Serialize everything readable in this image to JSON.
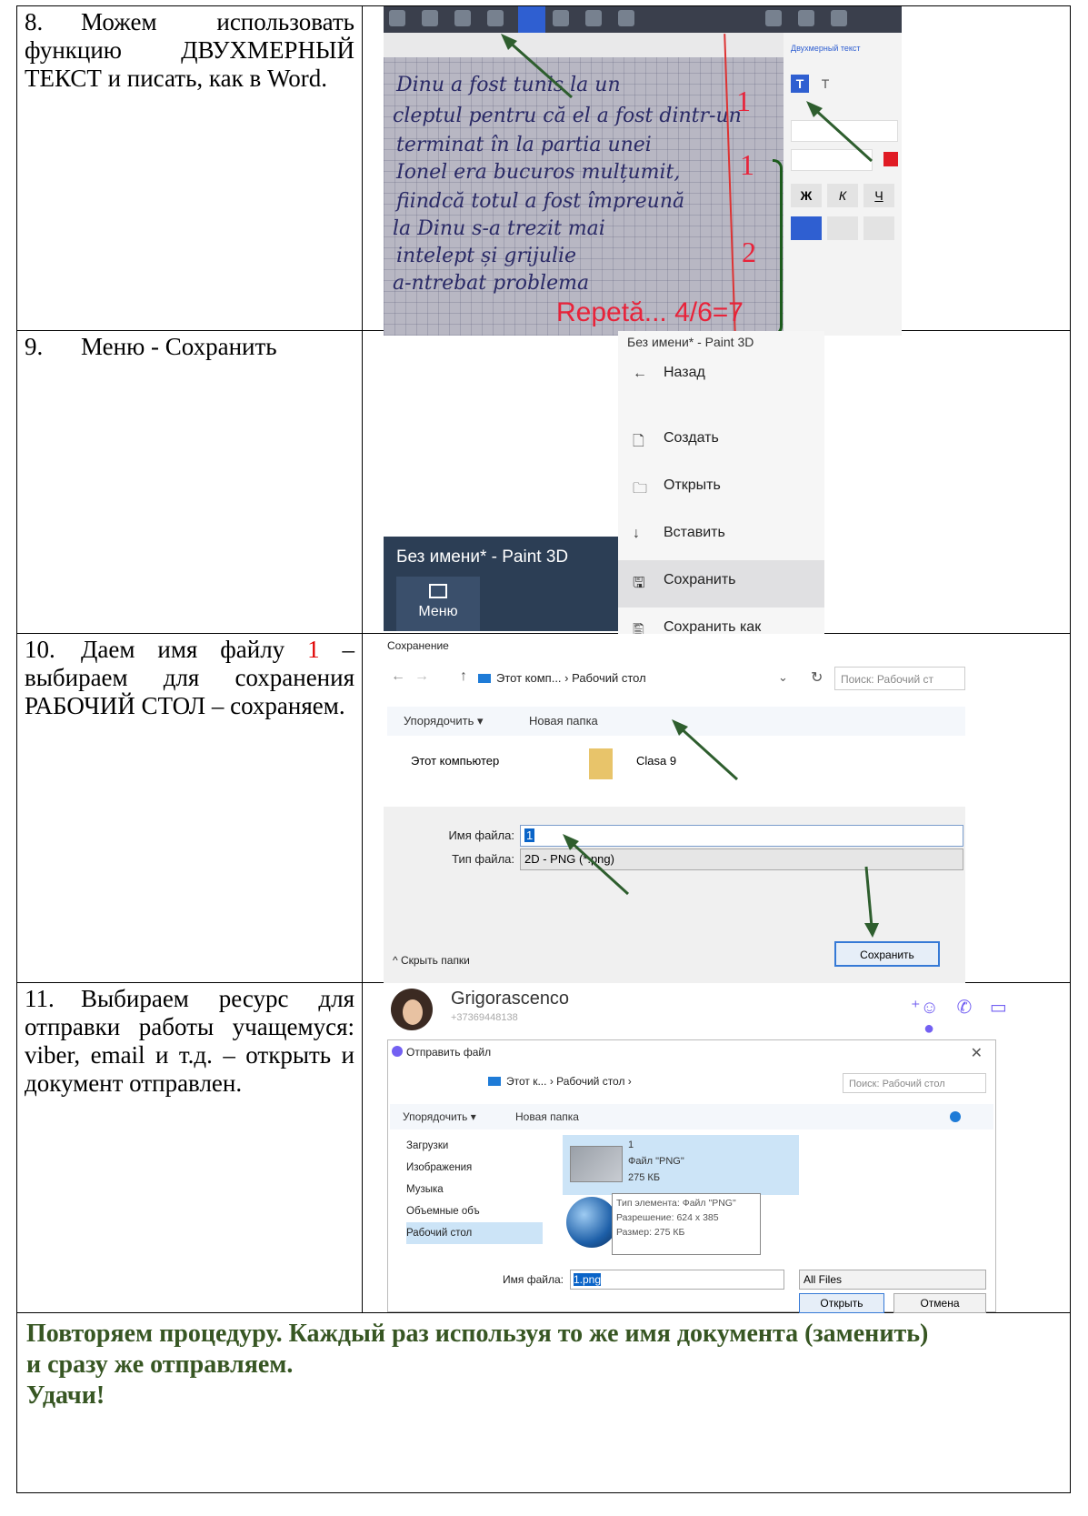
{
  "rows": [
    {
      "num": "8.",
      "pre": "Можем использовать функцию ДВУХМЕРНЫЙ ТЕКСТ и писать, как в Word.",
      "red": "",
      "post": ""
    },
    {
      "num": "9.",
      "pre": "Меню - Сохранить",
      "red": "",
      "post": ""
    },
    {
      "num": "10.",
      "pre": "Даем имя файлу ",
      "red": "1",
      "post": " – выбираем для сохранения РАБОЧИЙ СТОЛ – сохраняем."
    },
    {
      "num": "11.",
      "pre": "Выбираем ресурс для отправки работы учащемуся: viber, email и т.д. – открыть и документ отправлен.",
      "red": "",
      "post": ""
    }
  ],
  "footer": {
    "line1": "Повторяем процедуру. Каждый раз используя то же имя документа (заменить)",
    "line2": "и сразу же отправляем.",
    "line3": "Удачи!"
  },
  "shot8": {
    "panel_title": "Двухмерный текст",
    "bold": "Ж",
    "italic": "К",
    "underline": "Ч",
    "handwriting": [
      "Dinu a fost tunis la un",
      "cleptul pentru că el a fost dintr-un",
      "terminat în la partia unei",
      "Ionel era bucuros mulțumit,",
      "fiindcă totul a fost împreună",
      "la Dinu s-a trezit mai",
      "intelept și grijulie",
      "a-ntrebat problema",
      "Repetă… 4/6=7"
    ],
    "repeta": "Repetă... 4/6=7",
    "marks": [
      "1",
      "1",
      "2"
    ]
  },
  "shot9": {
    "window_title": "Без имени* - Paint 3D",
    "menu_button": "Меню",
    "header": "Без имени* - Paint 3D",
    "items": [
      {
        "icon": "←",
        "label": "Назад"
      },
      {
        "icon": "🗋",
        "label": "Создать"
      },
      {
        "icon": "🗀",
        "label": "Открыть"
      },
      {
        "icon": "↓",
        "label": "Вставить"
      },
      {
        "icon": "🖫",
        "label": "Сохранить"
      },
      {
        "icon": "🖺",
        "label": "Сохранить как"
      }
    ]
  },
  "shot10": {
    "title": "Сохранение",
    "path": "Этот комп... › Рабочий стол",
    "search": "Поиск: Рабочий ст",
    "organize": "Упорядочить ▾",
    "new_folder": "Новая папка",
    "tree_item": "Этот компьютер",
    "folder": "Clasa 9",
    "filename_label": "Имя файла:",
    "filename_value": "1",
    "filetype_label": "Тип файла:",
    "filetype_value": "2D - PNG (*.png)",
    "hide_folders": "Скрыть папки",
    "save_button": "Сохранить"
  },
  "shot11": {
    "contact_name": "Grigorascenco",
    "contact_phone": "+37369448138",
    "dialog_title": "Отправить файл",
    "path": "Этот к... › Рабочий стол ›",
    "search": "Поиск: Рабочий стол",
    "organize": "Упорядочить ▾",
    "new_folder": "Новая папка",
    "tree": [
      "Загрузки",
      "Изображения",
      "Музыка",
      "Объемные объ",
      "Рабочий стол"
    ],
    "file_name": "1",
    "file_type": "Файл \"PNG\"",
    "file_size": "275 КБ",
    "tooltip": [
      "Тип элемента: Файл \"PNG\"",
      "Разрешение: 624 x 385",
      "Размер: 275 КБ"
    ],
    "filename_label": "Имя файла:",
    "filename_value": "1.png",
    "filter": "All Files",
    "open_button": "Открыть",
    "cancel_button": "Отмена"
  },
  "colors": {
    "red": "#e00000",
    "footer_green": "#375623",
    "arrow_green": "#2e5e2e"
  }
}
